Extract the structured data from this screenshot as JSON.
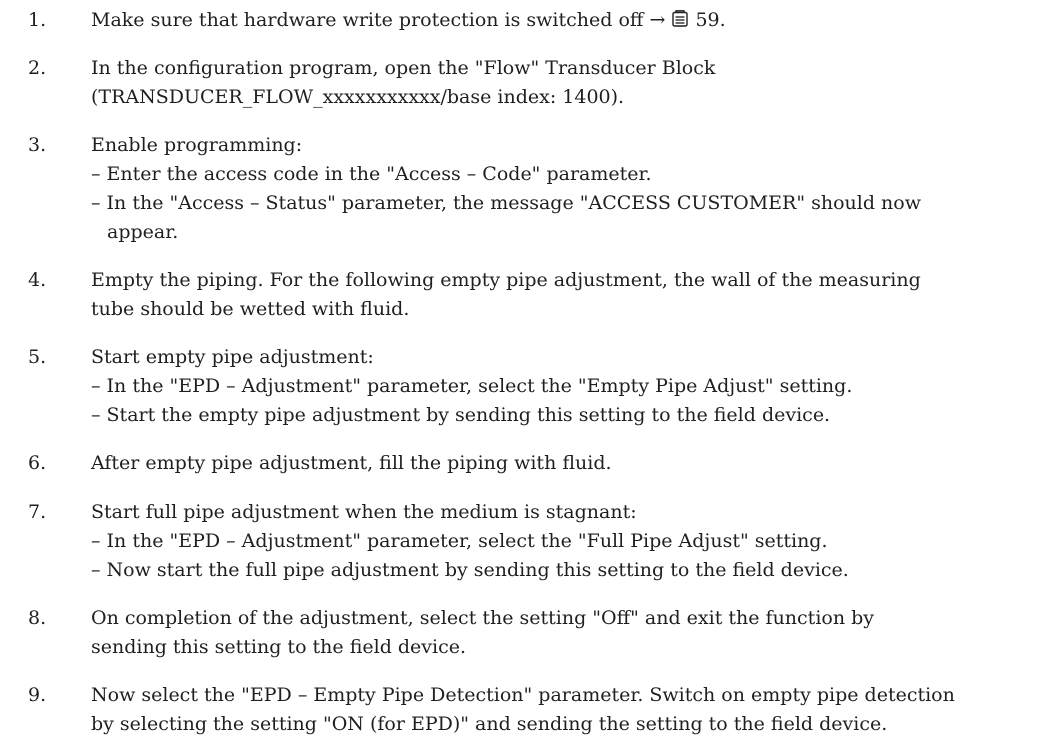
{
  "steps": [
    {
      "num": "1.",
      "text": "Make sure that hardware write protection is switched off",
      "arrow": "→",
      "page_icon": "book-icon",
      "page_ref": "59."
    },
    {
      "num": "2.",
      "lines": [
        "In the configuration program, open the \"Flow\" Transducer Block",
        "(TRANSDUCER_FLOW_xxxxxxxxxxx/base index: 1400)."
      ]
    },
    {
      "num": "3.",
      "lead": "Enable programming:",
      "subs": [
        "– Enter the access code in the \"Access – Code\" parameter.",
        "– In the \"Access – Status\" parameter, the message \"ACCESS CUSTOMER\" should now"
      ],
      "cont": "appear."
    },
    {
      "num": "4.",
      "lines": [
        "Empty the piping. For the following empty pipe adjustment, the wall of the measuring",
        "tube should be wetted with fluid."
      ]
    },
    {
      "num": "5.",
      "lead": "Start empty pipe adjustment:",
      "subs": [
        "– In the \"EPD – Adjustment\" parameter, select the \"Empty Pipe Adjust\" setting.",
        "– Start the empty pipe adjustment by sending this setting to the field device."
      ]
    },
    {
      "num": "6.",
      "lines": [
        "After empty pipe adjustment, fill the piping with fluid."
      ]
    },
    {
      "num": "7.",
      "lead": "Start full pipe adjustment when the medium is stagnant:",
      "subs": [
        "– In the \"EPD – Adjustment\" parameter, select the \"Full Pipe Adjust\" setting.",
        "– Now start the full pipe adjustment by sending this setting to the field device."
      ]
    },
    {
      "num": "8.",
      "lines": [
        "On completion of the adjustment, select the setting \"Off\" and exit the function by",
        "sending this setting to the field device."
      ]
    },
    {
      "num": "9.",
      "lines": [
        "Now select the \"EPD – Empty Pipe Detection\" parameter. Switch on empty pipe detection",
        "by selecting the setting \"ON (for EPD)\" and sending the setting to the field device."
      ]
    }
  ]
}
